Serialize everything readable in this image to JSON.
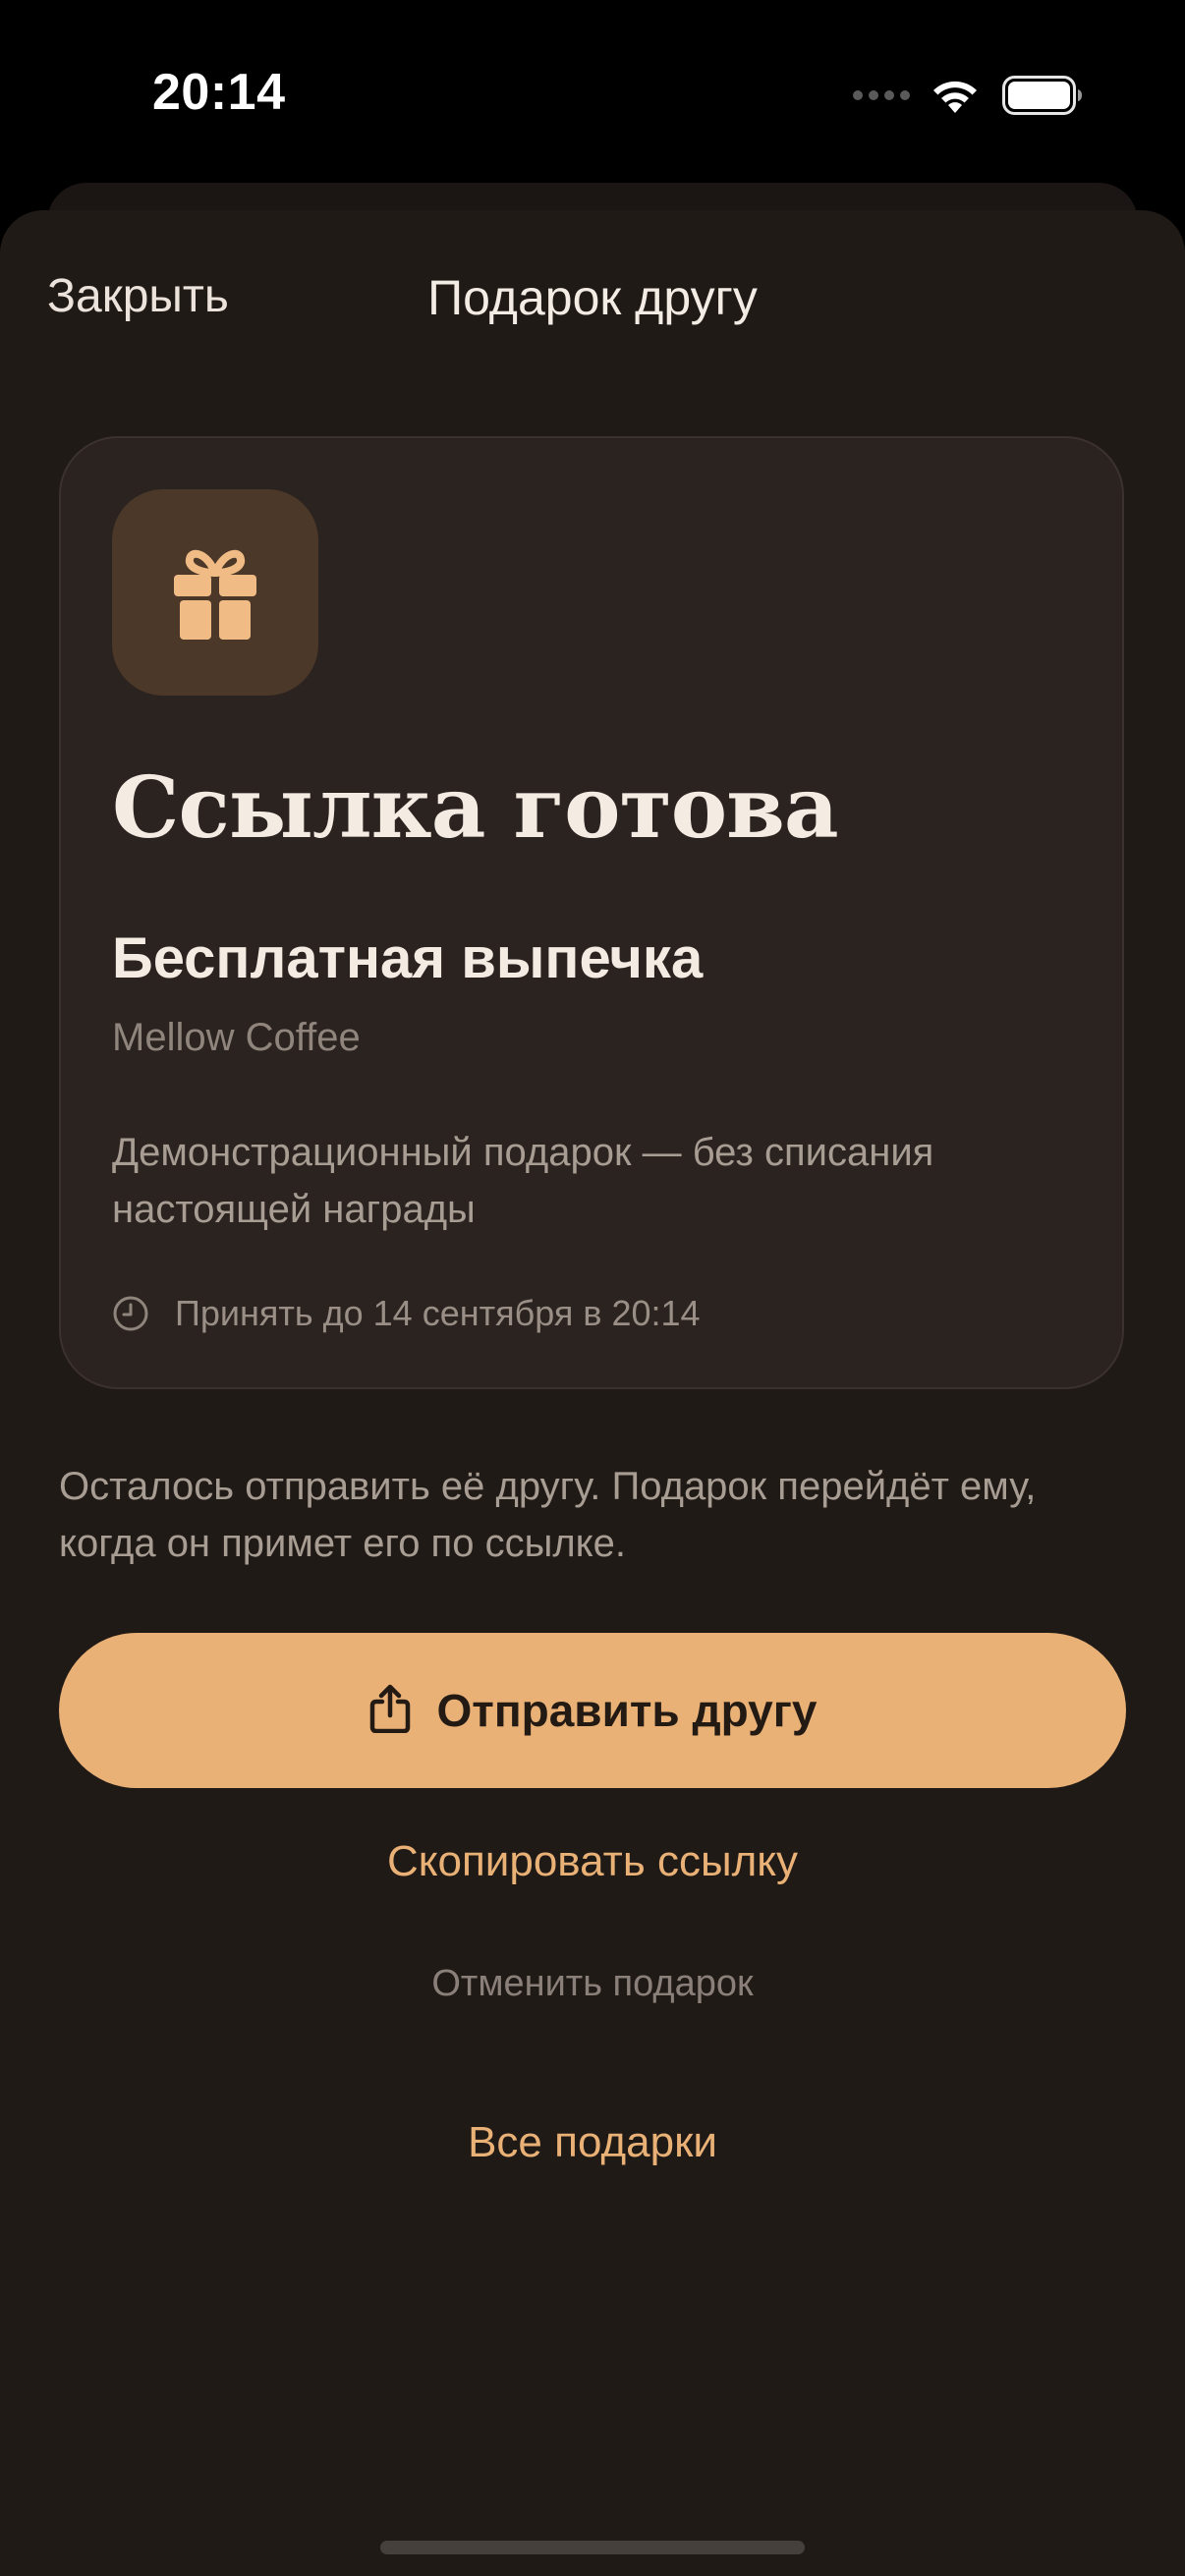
{
  "status_bar": {
    "time": "20:14",
    "icons": [
      "cellular-dots-icon",
      "wifi-icon",
      "battery-icon"
    ]
  },
  "nav": {
    "close_label": "Закрыть",
    "title": "Подарок другу"
  },
  "card": {
    "icon": "gift-icon",
    "heading": "Ссылка готова",
    "offer": "Бесплатная выпечка",
    "brand": "Mellow Coffee",
    "description": "Демонстрационный подарок — без списания настоящей награды",
    "expiry_icon": "clock-icon",
    "expiry": "Принять до 14 сентября в 20:14"
  },
  "info_text": "Осталось отправить её другу. Подарок перейдёт ему, когда он примет его по ссылке.",
  "actions": {
    "send_icon": "share-icon",
    "send_label": "Отправить другу",
    "copy_label": "Скопировать ссылку",
    "cancel_label": "Отменить подарок",
    "all_gifts_label": "Все подарки"
  },
  "colors": {
    "background": "#201a17",
    "card": "#2b2320",
    "accent": "#e9b176",
    "gift_tile": "#4c3828"
  }
}
